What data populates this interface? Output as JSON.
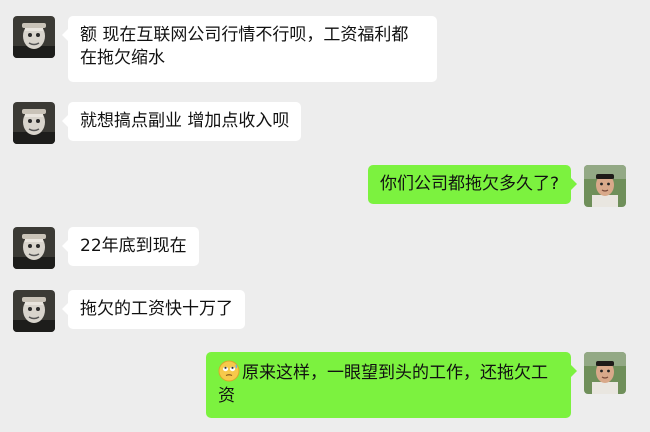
{
  "colors": {
    "background": "#ededed",
    "incoming_bubble": "#ffffff",
    "outgoing_bubble": "#7cf23f",
    "text": "#111111"
  },
  "messages": [
    {
      "side": "left",
      "text": "额  现在互联网公司行情不行呗，工资福利都在拖欠缩水"
    },
    {
      "side": "left",
      "text": "就想搞点副业 增加点收入呗"
    },
    {
      "side": "right",
      "text": "你们公司都拖欠多久了?"
    },
    {
      "side": "left",
      "text": "22年底到现在"
    },
    {
      "side": "left",
      "text": "拖欠的工资快十万了"
    },
    {
      "side": "right",
      "emoji": "rolling-eyes-sweat-emoji",
      "text": "原来这样，一眼望到头的工作，还拖欠工资"
    }
  ]
}
